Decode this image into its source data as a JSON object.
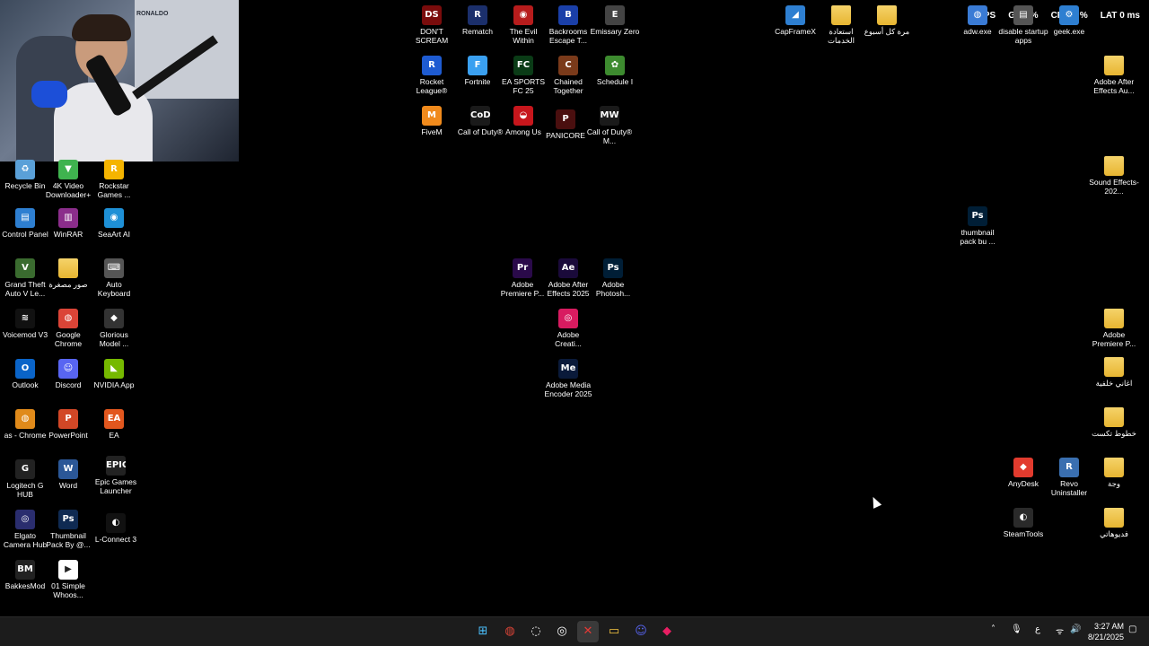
{
  "overlay": {
    "fps": "FPS",
    "gpu": "GPU",
    "gpu_val": "%",
    "cpu": "CPU",
    "cpu_val": "7 %",
    "lat": "LAT",
    "lat_val": "0 ms"
  },
  "icons": [
    {
      "id": "recycle-bin",
      "label": "Recycle Bin",
      "glyph": "♻",
      "color": "#5aa0d8"
    },
    {
      "id": "4k-video",
      "label": "4K Video Downloader+",
      "glyph": "▼",
      "color": "#3fb34f"
    },
    {
      "id": "rockstar",
      "label": "Rockstar Games ...",
      "glyph": "R",
      "color": "#f5b400"
    },
    {
      "id": "control-panel",
      "label": "Control Panel",
      "glyph": "▤",
      "color": "#2e7fd1"
    },
    {
      "id": "winrar",
      "label": "WinRAR",
      "glyph": "▥",
      "color": "#8b2d8b"
    },
    {
      "id": "seaart",
      "label": "SeaArt AI",
      "glyph": "◉",
      "color": "#1e90d6"
    },
    {
      "id": "gta",
      "label": "Grand Theft Auto V Le...",
      "glyph": "V",
      "color": "#3a6b2f"
    },
    {
      "id": "photos-ar",
      "label": "صور مصغرة",
      "glyph": "",
      "color": "#e7b531"
    },
    {
      "id": "auto-keyboard",
      "label": "Auto Keyboard",
      "glyph": "⌨",
      "color": "#555"
    },
    {
      "id": "voicemod",
      "label": "Voicemod V3",
      "glyph": "≋",
      "color": "#111"
    },
    {
      "id": "chrome",
      "label": "Google Chrome",
      "glyph": "◍",
      "color": "#db4437"
    },
    {
      "id": "glorious",
      "label": "Glorious Model ...",
      "glyph": "◆",
      "color": "#333"
    },
    {
      "id": "outlook",
      "label": "Outlook",
      "glyph": "O",
      "color": "#0a64c8"
    },
    {
      "id": "discord",
      "label": "Discord",
      "glyph": "☺",
      "color": "#5865f2"
    },
    {
      "id": "nvidia",
      "label": "NVIDIA App",
      "glyph": "◣",
      "color": "#76b900"
    },
    {
      "id": "as-chrome",
      "label": "as - Chrome",
      "glyph": "◍",
      "color": "#e08a1a"
    },
    {
      "id": "powerpoint",
      "label": "PowerPoint",
      "glyph": "P",
      "color": "#d24726"
    },
    {
      "id": "ea",
      "label": "EA",
      "glyph": "EA",
      "color": "#e2571e"
    },
    {
      "id": "logitech",
      "label": "Logitech G HUB",
      "glyph": "G",
      "color": "#222"
    },
    {
      "id": "word",
      "label": "Word",
      "glyph": "W",
      "color": "#2b5797"
    },
    {
      "id": "epic",
      "label": "Epic Games Launcher",
      "glyph": "EPIC",
      "color": "#222"
    },
    {
      "id": "elgato",
      "label": "Elgato Camera Hub",
      "glyph": "◎",
      "color": "#2a2d6e"
    },
    {
      "id": "thumbnail-pack",
      "label": "Thumbnail Pack By @...",
      "glyph": "Ps",
      "color": "#0f2a52"
    },
    {
      "id": "l-connect",
      "label": "L-Connect 3",
      "glyph": "◐",
      "color": "#111"
    },
    {
      "id": "bakkesmod",
      "label": "BakkesMod",
      "glyph": "BM",
      "color": "#222"
    },
    {
      "id": "simple-whoosh",
      "label": "01 Simple Whoos...",
      "glyph": "▶",
      "color": "#fff"
    },
    {
      "id": "dont-scream",
      "label": "DON'T SCREAM",
      "glyph": "DS",
      "color": "#7a0c0c"
    },
    {
      "id": "rematch",
      "label": "Rematch",
      "glyph": "R",
      "color": "#1b2f6b"
    },
    {
      "id": "evil-within",
      "label": "The Evil Within",
      "glyph": "◉",
      "color": "#b71c1c"
    },
    {
      "id": "backrooms",
      "label": "Backrooms Escape T...",
      "glyph": "B",
      "color": "#1a3fa8"
    },
    {
      "id": "emissary",
      "label": "Emissary Zero",
      "glyph": "E",
      "color": "#444"
    },
    {
      "id": "rocket-league",
      "label": "Rocket League®",
      "glyph": "R",
      "color": "#1e5bd1"
    },
    {
      "id": "fortnite",
      "label": "Fortnite",
      "glyph": "F",
      "color": "#3aa0f0"
    },
    {
      "id": "fc25",
      "label": "EA SPORTS FC 25",
      "glyph": "FC",
      "color": "#0a3b16"
    },
    {
      "id": "chained",
      "label": "Chained Together",
      "glyph": "C",
      "color": "#7a3a1a"
    },
    {
      "id": "schedule",
      "label": "Schedule I",
      "glyph": "✿",
      "color": "#3d8b2f"
    },
    {
      "id": "fivem",
      "label": "FiveM",
      "glyph": "M",
      "color": "#f08a1c"
    },
    {
      "id": "cod",
      "label": "Call of Duty®",
      "glyph": "CoD",
      "color": "#1a1a1a"
    },
    {
      "id": "among-us",
      "label": "Among Us",
      "glyph": "◒",
      "color": "#c7161c"
    },
    {
      "id": "panicore",
      "label": "PANICORE",
      "glyph": "P",
      "color": "#4a0f0f"
    },
    {
      "id": "cod-mw",
      "label": "Call of Duty® M...",
      "glyph": "MW",
      "color": "#1a1a1a"
    },
    {
      "id": "premiere",
      "label": "Adobe Premiere P...",
      "glyph": "Pr",
      "color": "#2a0a4a"
    },
    {
      "id": "after-effects",
      "label": "Adobe After Effects 2025",
      "glyph": "Ae",
      "color": "#1a0a3a"
    },
    {
      "id": "photoshop",
      "label": "Adobe Photosh...",
      "glyph": "Ps",
      "color": "#001e36"
    },
    {
      "id": "creative-cloud",
      "label": "Adobe Creati...",
      "glyph": "◎",
      "color": "#d81b60"
    },
    {
      "id": "media-encoder",
      "label": "Adobe Media Encoder 2025",
      "glyph": "Me",
      "color": "#0a1a3a"
    },
    {
      "id": "capframex",
      "label": "CapFrameX",
      "glyph": "◢",
      "color": "#2e7fd1"
    },
    {
      "id": "folder-services",
      "label": "استعادة الخدمات",
      "glyph": "",
      "color": "#e7b531"
    },
    {
      "id": "folder-weekly",
      "label": "مرة كل أسبوع",
      "glyph": "",
      "color": "#e7b531"
    },
    {
      "id": "adw",
      "label": "adw.exe",
      "glyph": "◍",
      "color": "#3a7bd5"
    },
    {
      "id": "disable-startup",
      "label": "disable startup apps",
      "glyph": "▤",
      "color": "#555"
    },
    {
      "id": "geek",
      "label": "geek.exe",
      "glyph": "⚙",
      "color": "#2e7fd1"
    },
    {
      "id": "folder-ae",
      "label": "Adobe After Effects Au...",
      "glyph": "",
      "color": "#e7b531"
    },
    {
      "id": "folder-sfx",
      "label": "Sound Effects-202...",
      "glyph": "",
      "color": "#e7b531"
    },
    {
      "id": "thumbnail-psd",
      "label": "thumbnail pack bu ...",
      "glyph": "Ps",
      "color": "#001e36"
    },
    {
      "id": "folder-premiere",
      "label": "Adobe Premiere P...",
      "glyph": "",
      "color": "#e7b531"
    },
    {
      "id": "folder-songs",
      "label": "اغاني خلفية",
      "glyph": "",
      "color": "#e7b531"
    },
    {
      "id": "folder-fonts",
      "label": "خطوط تكست",
      "glyph": "",
      "color": "#e7b531"
    },
    {
      "id": "anydesk",
      "label": "AnyDesk",
      "glyph": "◆",
      "color": "#e23b2e"
    },
    {
      "id": "revo",
      "label": "Revo Uninstaller",
      "glyph": "R",
      "color": "#3a6fb0"
    },
    {
      "id": "folder-face",
      "label": "وجة",
      "glyph": "",
      "color": "#e7b531"
    },
    {
      "id": "steamtools",
      "label": "SteamTools",
      "glyph": "◐",
      "color": "#2a2a2a"
    },
    {
      "id": "folder-videos",
      "label": "فديوهاتي",
      "glyph": "",
      "color": "#e7b531"
    }
  ],
  "webcam": {
    "jersey_text": "RONALDO"
  },
  "taskbar": {
    "start": "⊞",
    "chrome": "◍",
    "app2": "◌",
    "app3": "◎",
    "app4": "✕",
    "explorer": "▭",
    "discord": "☺",
    "app6": "◆",
    "tray_chevron": "˄",
    "tray_mic": "🎙",
    "tray_lang": "ع",
    "tray_wifi": "ᯤ",
    "tray_vol": "🔊",
    "time": "3:27 AM",
    "date": "8/21/2025"
  }
}
